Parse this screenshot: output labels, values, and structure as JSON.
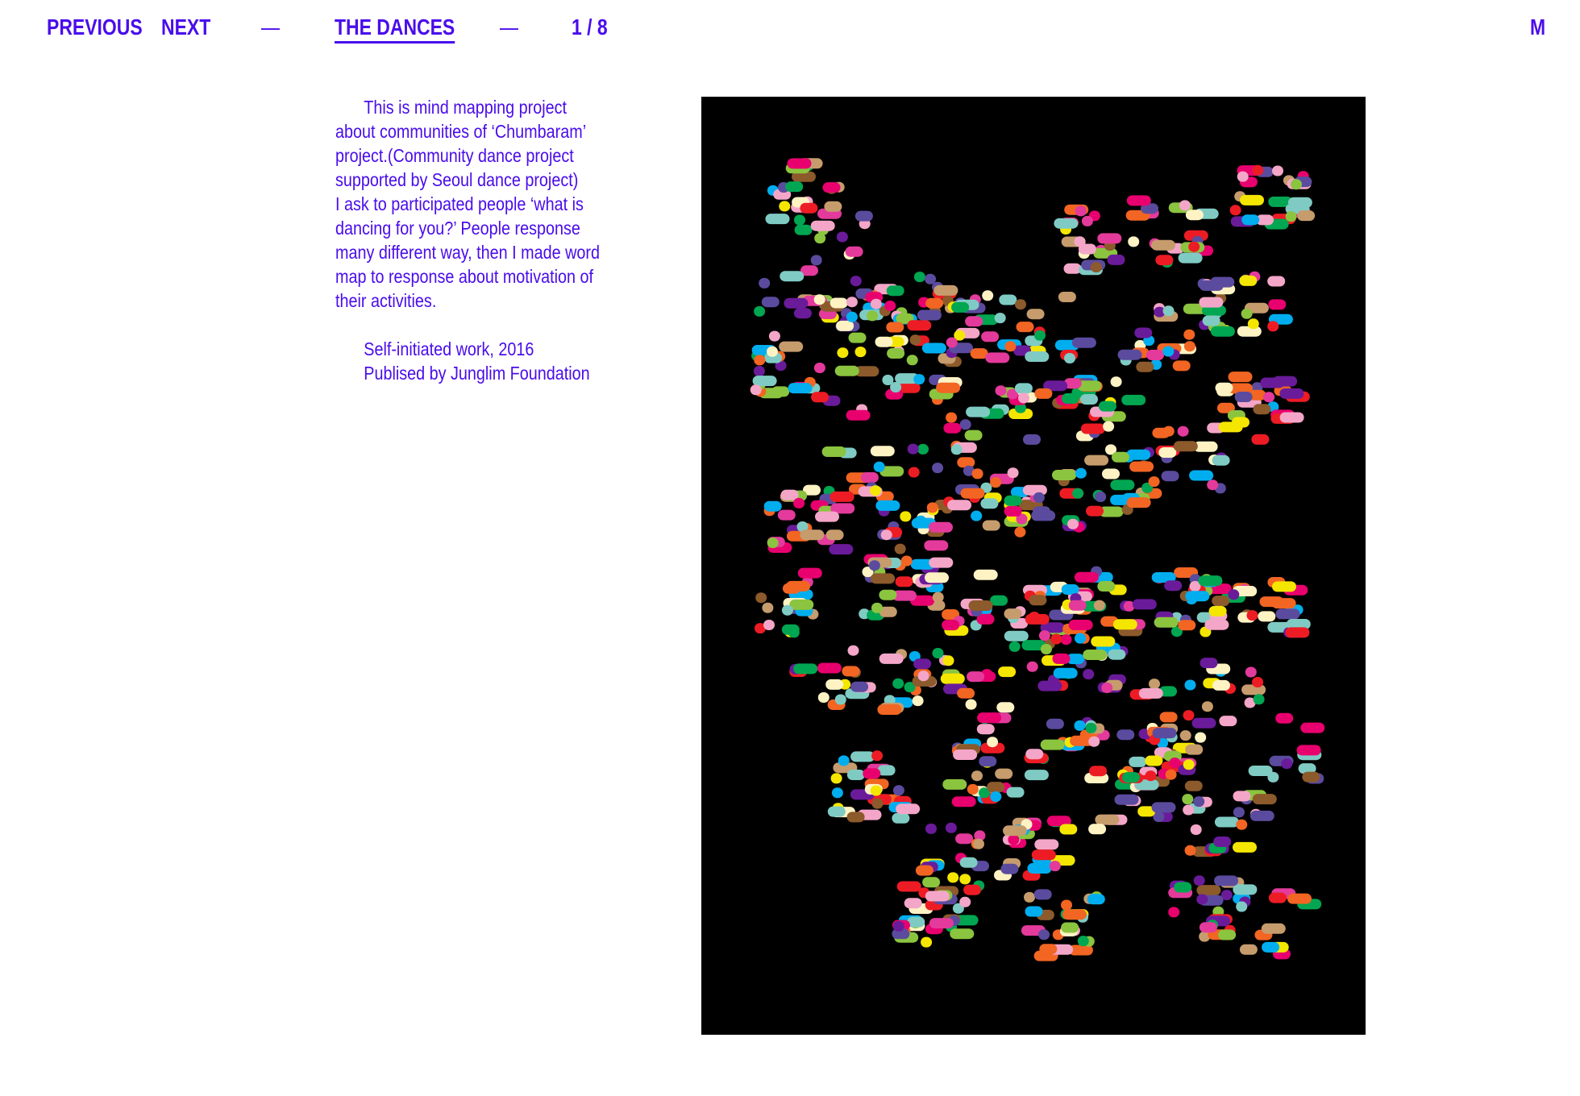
{
  "nav": {
    "previous": "PREVIOUS",
    "next": "NEXT",
    "sep1": "—",
    "title": "THE DANCES",
    "sep2": "—",
    "counter": "1 / 8",
    "menu": "M"
  },
  "description": {
    "paragraph_lines": [
      "This is mind mapping project",
      "about communities of ‘Chumbaram’",
      "project.(Community dance project",
      "supported by Seoul dance project)",
      "I ask to participated people ‘what is",
      "dancing for you?’ People response",
      "many different way, then I made word",
      "map to response about motivation of",
      "their activities."
    ],
    "credit_line1": "Self-initiated work, 2016",
    "credit_line2": "Publised by Junglim Foundation"
  },
  "artwork": {
    "background": "#000000",
    "palette": [
      "#5B4B9E",
      "#7FCBC4",
      "#F4A6C8",
      "#E8006E",
      "#F5E600",
      "#8BC43F",
      "#00A651",
      "#F26522",
      "#C69C6D",
      "#8C5A2B",
      "#00AEEF",
      "#6A1B9A",
      "#ED1C24",
      "#E33A9C",
      "#FFF3C4"
    ]
  },
  "colors": {
    "accent": "#4A0DEB",
    "background": "#FFFFFF"
  }
}
